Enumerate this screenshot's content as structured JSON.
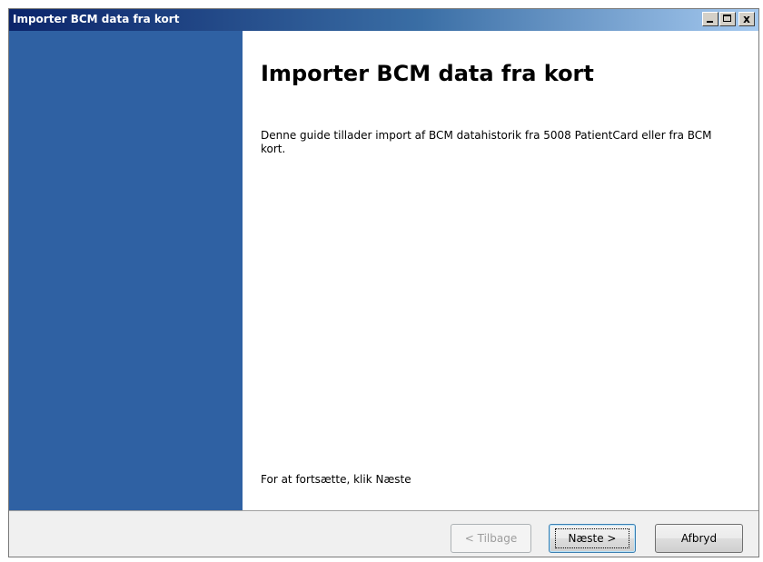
{
  "window": {
    "title": "Importer BCM data fra kort"
  },
  "titlebar_buttons": {
    "minimize": "minimize-icon",
    "maximize": "maximize-icon",
    "close": "close-icon",
    "close_glyph": "x"
  },
  "content": {
    "heading": "Importer BCM data fra kort",
    "description": "Denne guide tillader import af BCM datahistorik fra 5008 PatientCard eller fra BCM kort.",
    "continue_hint": "For at fortsætte, klik Næste"
  },
  "buttons": {
    "back": "< Tilbage",
    "next": "Næste >",
    "cancel": "Afbryd"
  },
  "colors": {
    "side_panel": "#2f61a3",
    "titlebar_start": "#0b246a",
    "titlebar_end": "#a6caf0"
  }
}
